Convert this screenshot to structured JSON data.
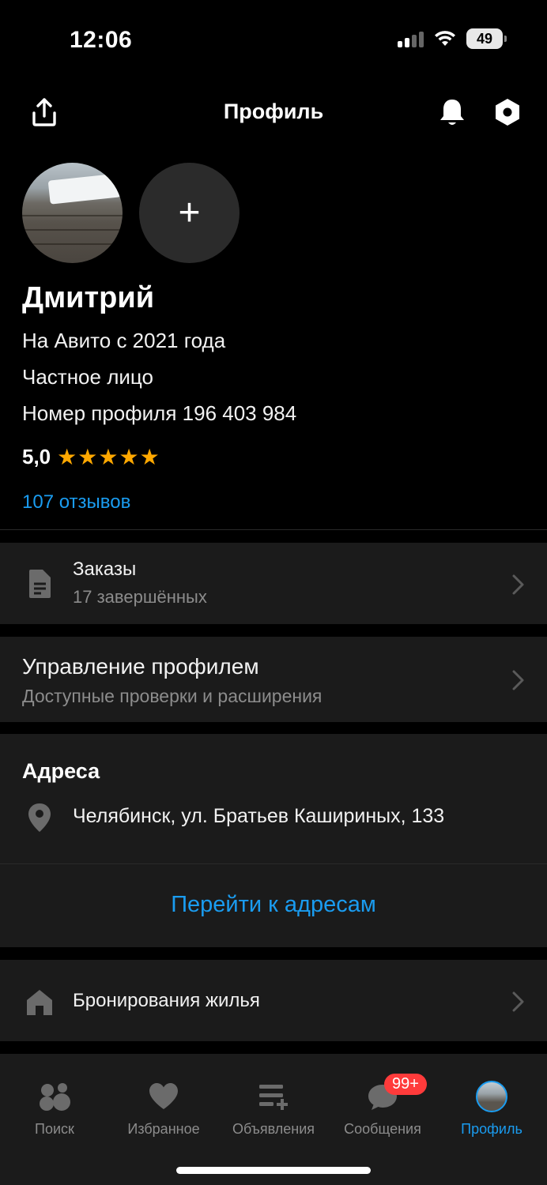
{
  "status": {
    "time": "12:06",
    "battery": "49"
  },
  "header": {
    "title": "Профиль",
    "share_icon": "share-icon",
    "bell_icon": "bell-icon",
    "settings_icon": "settings-icon"
  },
  "profile": {
    "add_photo": "+",
    "name": "Дмитрий",
    "since": "На Авито с 2021 года",
    "type": "Частное лицо",
    "number": "Номер профиля 196 403 984",
    "rating": "5,0",
    "stars": "★★★★★",
    "rating_stars": 5,
    "reviews": "107 отзывов"
  },
  "orders": {
    "title": "Заказы",
    "subtitle": "17 завершённых"
  },
  "manage": {
    "title": "Управление профилем",
    "subtitle": "Доступные проверки и расширения"
  },
  "addresses": {
    "title": "Адреса",
    "address": "Челябинск, ул. Братьев Кашириных, 133",
    "link": "Перейти к адресам"
  },
  "booking": {
    "title": "Бронирования жилья"
  },
  "tabs": [
    {
      "label": "Поиск",
      "icon": "search-dots-icon"
    },
    {
      "label": "Избранное",
      "icon": "heart-icon"
    },
    {
      "label": "Объявления",
      "icon": "listings-icon"
    },
    {
      "label": "Сообщения",
      "icon": "chat-icon",
      "badge": "99+"
    },
    {
      "label": "Профиль",
      "icon": "profile-avatar",
      "active": true
    }
  ],
  "colors": {
    "accent": "#1a9cf0",
    "star": "#ffa800",
    "badge": "#ff3b3b",
    "card": "#1b1b1b",
    "background": "#000000"
  }
}
